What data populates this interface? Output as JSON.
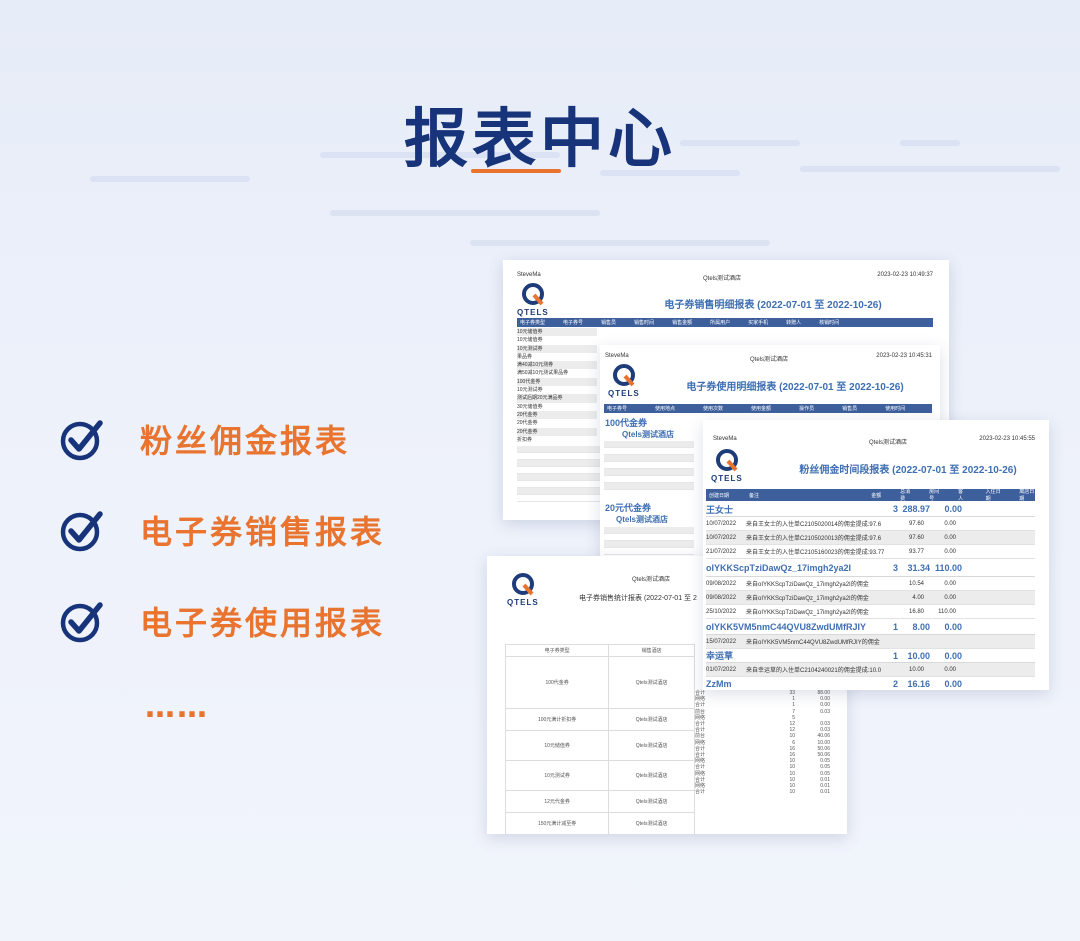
{
  "title": "报表中心",
  "features": [
    "粉丝佣金报表",
    "电子券销售报表",
    "电子券使用报表"
  ],
  "more": "……",
  "colors": {
    "title": "#17347a",
    "accent": "#e8742f",
    "report_blue": "#3f6fb3",
    "header_bar": "#3d5f9c"
  },
  "logo_text": "QTELS",
  "report_sales": {
    "user": "SteveMa",
    "hotel": "Qtels测试酒店",
    "timestamp": "2023-02-23 10:49:37",
    "title": "电子券销售明细报表 (2022-07-01 至 2022-10-26)",
    "headers": [
      "电子券类型",
      "电子券号",
      "销售员",
      "销售时间",
      "销售金额",
      "所属用户",
      "买家手机",
      "转赠人",
      "核销时间"
    ],
    "rows": [
      "10元储值券",
      "10元储值券",
      "10元测试券",
      "果品券",
      "满40减10元测券",
      "满50减10元测试果品券",
      "100代金券",
      "10元测试券",
      "测试后期20元满品券",
      "30元储值券",
      "20代金券",
      "20代金券",
      "20代金券",
      "折扣券"
    ]
  },
  "report_usage": {
    "user": "SteveMa",
    "hotel": "Qtels测试酒店",
    "timestamp": "2023-02-23 10:45:31",
    "title": "电子券使用明细报表 (2022-07-01 至 2022-10-26)",
    "headers": [
      "电子券号",
      "使用地点",
      "使用次数",
      "使用金额",
      "操作员",
      "销售员",
      "使用时间"
    ],
    "groups": [
      "100代金券",
      "Qtels测试酒店",
      "20元代金券",
      "Qtels测试酒店"
    ]
  },
  "report_commission": {
    "user": "SteveMa",
    "hotel": "Qtels测试酒店",
    "timestamp": "2023-02-23 10:45:55",
    "title": "粉丝佣金时间段报表 (2022-07-01 至 2022-10-26)",
    "headers": [
      "创建日期",
      "备注",
      "金额",
      "总消费",
      "房间号",
      "客人",
      "入住日期",
      "离店日期"
    ],
    "groups": [
      {
        "name": "王女士",
        "count": "3",
        "amount": "288.97",
        "fee": "0.00",
        "rows": [
          {
            "date": "10/07/2022",
            "note": "来自王女士的入住单C2105020014的佣金提成:97.6",
            "amount": "97.60",
            "fee": "0.00"
          },
          {
            "date": "10/07/2022",
            "note": "来自王女士的入住单C2105020013的佣金提成:97.6",
            "amount": "97.60",
            "fee": "0.00"
          },
          {
            "date": "21/07/2022",
            "note": "来自王女士的入住单C2105160023的佣金提成:93.77",
            "amount": "93.77",
            "fee": "0.00"
          }
        ]
      },
      {
        "name": "oIYKKScpTziDawQz_17imgh2ya2I",
        "count": "3",
        "amount": "31.34",
        "fee": "110.00",
        "rows": [
          {
            "date": "09/08/2022",
            "note": "来自oIYKKScpTziDawQz_17imgh2ya2I的佣金",
            "amount": "10.54",
            "fee": "0.00"
          },
          {
            "date": "09/08/2022",
            "note": "来自oIYKKScpTziDawQz_17imgh2ya2I的佣金",
            "amount": "4.00",
            "fee": "0.00"
          },
          {
            "date": "25/10/2022",
            "note": "来自oIYKKScpTziDawQz_17imgh2ya2I的佣金",
            "amount": "16.80",
            "fee": "110.00"
          }
        ]
      },
      {
        "name": "oIYKK5VM5nmC44QVU8ZwdUMfRJIY",
        "count": "1",
        "amount": "8.00",
        "fee": "0.00",
        "rows": [
          {
            "date": "15/07/2022",
            "note": "来自oIYKK5VM5nmC44QVU8ZwdUMfRJIY的佣金",
            "amount": "",
            "fee": ""
          }
        ]
      },
      {
        "name": "幸运草",
        "count": "1",
        "amount": "10.00",
        "fee": "0.00",
        "rows": [
          {
            "date": "01/07/2022",
            "note": "来自幸运草的入住单C2104240021的佣金提成:10.0",
            "amount": "10.00",
            "fee": "0.00"
          }
        ]
      },
      {
        "name": "ZzMm",
        "count": "2",
        "amount": "16.16",
        "fee": "0.00",
        "rows": []
      }
    ]
  },
  "report_stats": {
    "hotel": "Qtels测试酒店",
    "title": "电子券销售统计报表 (2022-07-01 至 2",
    "headers": [
      "电子券类型",
      "销售酒店"
    ],
    "types": [
      "100代金券",
      "100元满计折扣券",
      "10元储值券",
      "10元测试券",
      "12元代金券",
      "150元满计减至券"
    ],
    "right_rows": [
      [
        "合计",
        "33",
        "88.00"
      ],
      [
        "网络",
        "1",
        "0.00"
      ],
      [
        "合计",
        "1",
        "0.00"
      ],
      [
        "前台",
        "7",
        "0.03"
      ],
      [
        "网络",
        "5",
        ""
      ],
      [
        "合计",
        "12",
        "0.03"
      ],
      [
        "合计",
        "12",
        "0.03"
      ],
      [
        "前台",
        "10",
        "40.06"
      ],
      [
        "网络",
        "6",
        "10.00"
      ],
      [
        "合计",
        "16",
        "50.06"
      ],
      [
        "合计",
        "16",
        "50.06"
      ],
      [
        "网络",
        "10",
        "0.05"
      ],
      [
        "合计",
        "10",
        "0.05"
      ],
      [
        "网络",
        "10",
        "0.05"
      ],
      [
        "合计",
        "10",
        "0.01"
      ],
      [
        "网络",
        "10",
        "0.01"
      ],
      [
        "合计",
        "10",
        "0.01"
      ]
    ]
  }
}
